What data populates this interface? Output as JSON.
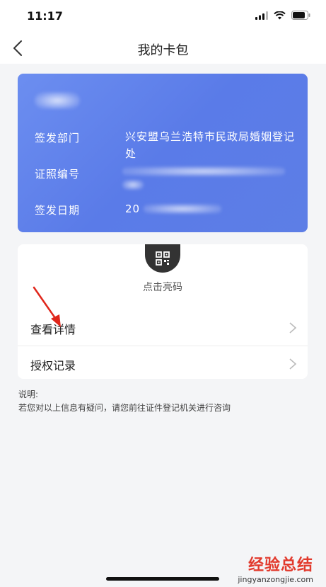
{
  "status_bar": {
    "time": "11:17"
  },
  "nav": {
    "title": "我的卡包"
  },
  "card": {
    "rows": [
      {
        "label": "签发部门",
        "value": "兴安盟乌兰浩特市民政局婚姻登记处"
      },
      {
        "label": "证照编号",
        "value": ""
      },
      {
        "label": "签发日期",
        "value": "20"
      }
    ],
    "color": "#5d7ee6"
  },
  "qr": {
    "label": "点击亮码",
    "icon": "qr-code-icon"
  },
  "list": [
    {
      "label": "查看详情"
    },
    {
      "label": "授权记录"
    }
  ],
  "note": {
    "title": "说明:",
    "text": "若您对以上信息有疑问，请您前往证件登记机关进行咨询"
  },
  "watermark": {
    "cn": "经验总结",
    "en": "jingyanzongjie.com"
  }
}
